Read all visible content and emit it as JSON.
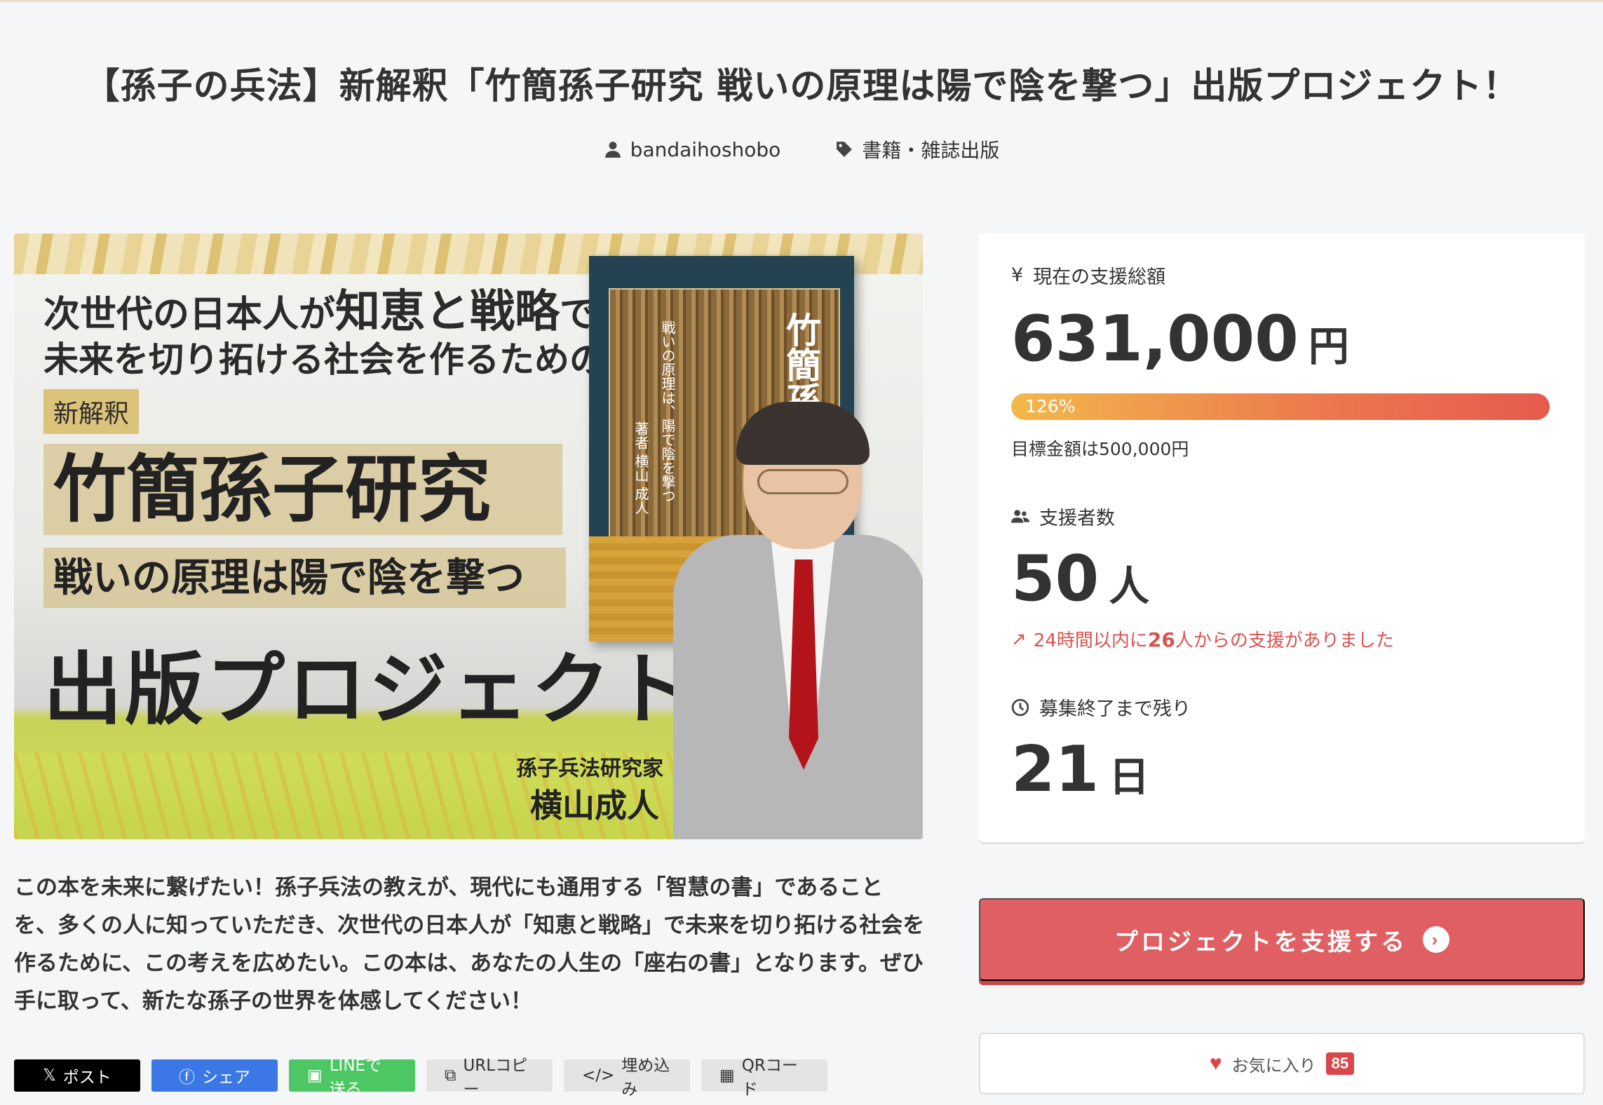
{
  "project": {
    "title": "【孫子の兵法】新解釈「竹簡孫子研究 戦いの原理は陽で陰を撃つ」出版プロジェクト！",
    "owner": "bandaihoshobo",
    "category": "書籍・雑誌出版"
  },
  "hero": {
    "line1_a": "次世代の日本人が",
    "line1_b": "知恵と戦略",
    "line1_c": "で",
    "line2": "未来を切り拓ける社会を作るための",
    "tag": "新解釈",
    "big_title": "竹簡孫子研究",
    "subtitle": "戦いの原理は陽で陰を撃つ",
    "publish": "出版プロジェクト",
    "author_role": "孫子兵法研究家",
    "author_name": "横山成人",
    "book_title": "竹簡孫子研究",
    "book_subtitle": "戦いの原理は、陽で陰を撃つ",
    "book_author": "著者 横山 成人"
  },
  "stats": {
    "amount_label": "現在の支援総額",
    "amount_value": "631,000",
    "amount_unit": "円",
    "progress_text": "126%",
    "progress_percent": 126,
    "goal_text": "目標金額は500,000円",
    "backers_label": "支援者数",
    "backers_value": "50",
    "backers_unit": "人",
    "trend_prefix": "24時間以内に",
    "trend_count": "26",
    "trend_suffix": "人からの支援がありました",
    "remaining_label": "募集終了まで残り",
    "remaining_value": "21",
    "remaining_unit": "日"
  },
  "description": "この本を未来に繋げたい！孫子兵法の教えが、現代にも通用する「智慧の書」であることを、多くの人に知っていただき、次世代の日本人が「知恵と戦略」で未来を切り拓ける社会を作るために、この考えを広めたい。この本は、あなたの人生の「座右の書」となります。ぜひ手に取って、新たな孫子の世界を体感してください！",
  "actions": {
    "support_label": "プロジェクトを支援する",
    "favorite_label": "お気に入り",
    "favorite_count": "85"
  },
  "share": {
    "x": "ポスト",
    "facebook": "シェア",
    "line": "LINEで送る",
    "url": "URLコピー",
    "embed": "埋め込み",
    "qr": "QRコード"
  },
  "colors": {
    "accent": "#df5f63",
    "progress_start": "#f2b84b",
    "progress_end": "#e65a4e",
    "trend": "#d9534f"
  }
}
